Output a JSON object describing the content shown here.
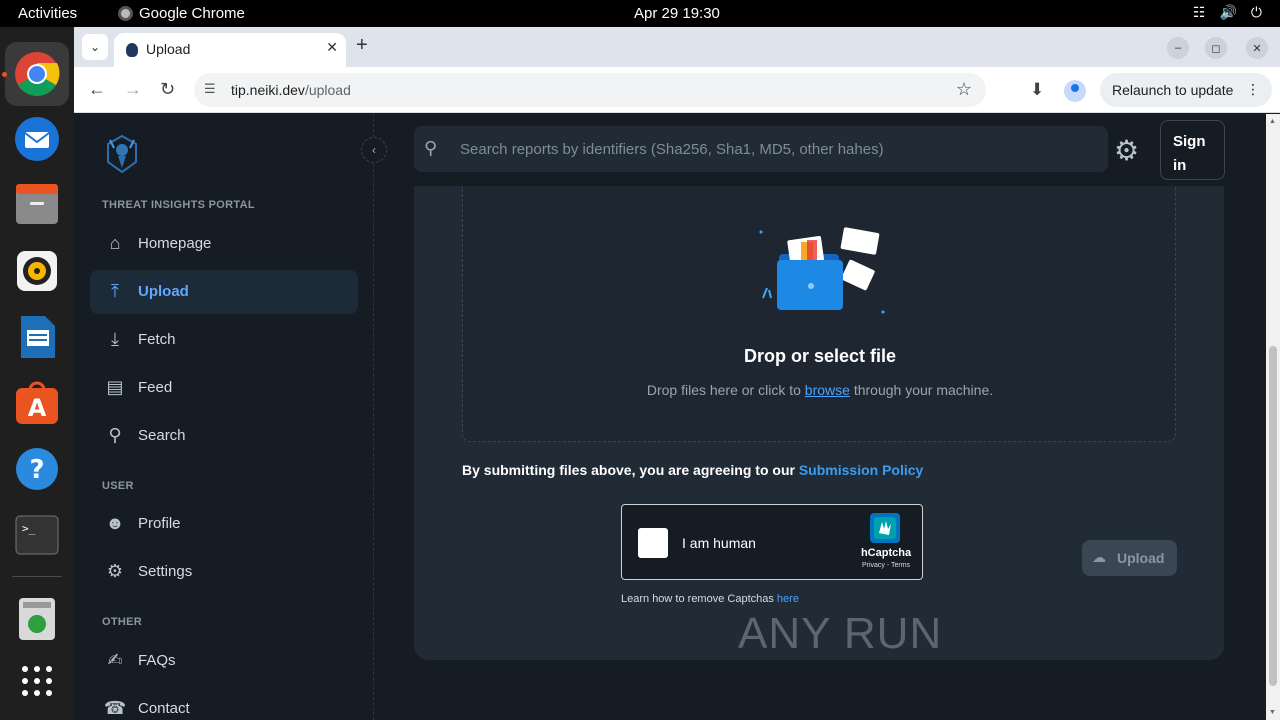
{
  "system": {
    "activities": "Activities",
    "app_name": "Google Chrome",
    "clock": "Apr 29  19:30"
  },
  "dock": {
    "apps": [
      "chrome-icon",
      "thunderbird-icon",
      "files-icon",
      "rhythmbox-icon",
      "writer-icon",
      "app-center-icon",
      "help-icon",
      "terminal-icon",
      "trash-icon",
      "show-apps-icon"
    ]
  },
  "browser": {
    "tab_title": "Upload",
    "url_host": "tip.neiki.dev",
    "url_path": "/upload",
    "relaunch_label": "Relaunch to update"
  },
  "sidebar": {
    "section_portal": "THREAT INSIGHTS PORTAL",
    "section_user": "USER",
    "section_other": "OTHER",
    "items": [
      {
        "label": "Homepage"
      },
      {
        "label": "Upload"
      },
      {
        "label": "Fetch"
      },
      {
        "label": "Feed"
      },
      {
        "label": "Search"
      },
      {
        "label": "Profile"
      },
      {
        "label": "Settings"
      },
      {
        "label": "FAQs"
      },
      {
        "label": "Contact"
      }
    ]
  },
  "header": {
    "search_placeholder": "Search reports by identifiers (Sha256, Sha1, MD5, other hahes)",
    "signin_line1": "Sign",
    "signin_line2": "in"
  },
  "upload": {
    "drop_title": "Drop or select file",
    "drop_sub_before": "Drop files here or click to ",
    "drop_sub_link": "browse",
    "drop_sub_after": " through your machine.",
    "policy_text": "By submitting files above, you are agreeing to our ",
    "policy_link": "Submission Policy",
    "captcha_label": "I am human",
    "captcha_brand": "hCaptcha",
    "captcha_links": "Privacy - Terms",
    "captcha_help_text": "Learn how to remove Captchas ",
    "captcha_help_link": "here",
    "upload_button": "Upload"
  },
  "watermark": "ANY RUN",
  "colors": {
    "accent": "#3b9cf0",
    "background": "#161c24",
    "card": "#212b36"
  }
}
